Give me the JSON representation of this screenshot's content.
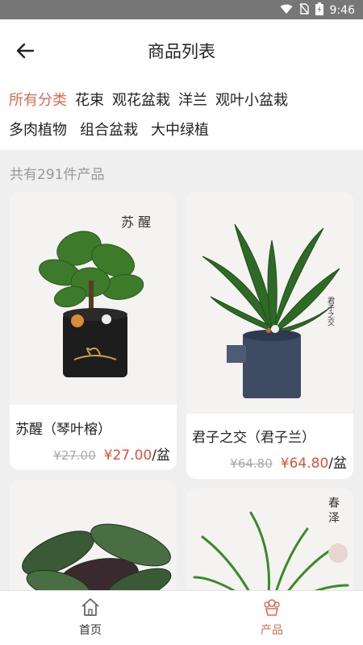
{
  "status_bar": {
    "time": "9:46"
  },
  "header": {
    "title": "商品列表",
    "back_icon": "arrow-left-icon"
  },
  "categories": {
    "row1": [
      "所有分类",
      "花束",
      "观花盆栽",
      "洋兰",
      "观叶小盆栽"
    ],
    "row2": [
      "多肉植物",
      "组合盆栽",
      "大中绿植"
    ],
    "active": "所有分类",
    "active_color": "#e5694f"
  },
  "count_text": "共有291件产品",
  "products": [
    {
      "name": "苏醒（琴叶榕）",
      "old_price": "¥27.00",
      "price": "¥27.00",
      "unit": "/盆",
      "image_text": "苏 醒"
    },
    {
      "name": "君子之交（君子兰）",
      "old_price": "¥64.80",
      "price": "¥64.80",
      "unit": "/盆",
      "image_text": "君子之交"
    },
    {
      "name": "",
      "image_text": ""
    },
    {
      "name": "",
      "image_text": "春 泽"
    }
  ],
  "bottom_nav": [
    {
      "label": "首页",
      "icon": "home-icon",
      "active": false
    },
    {
      "label": "产品",
      "icon": "plant-icon",
      "active": true
    }
  ],
  "colors": {
    "accent": "#e5694f",
    "price": "#e5503a"
  }
}
